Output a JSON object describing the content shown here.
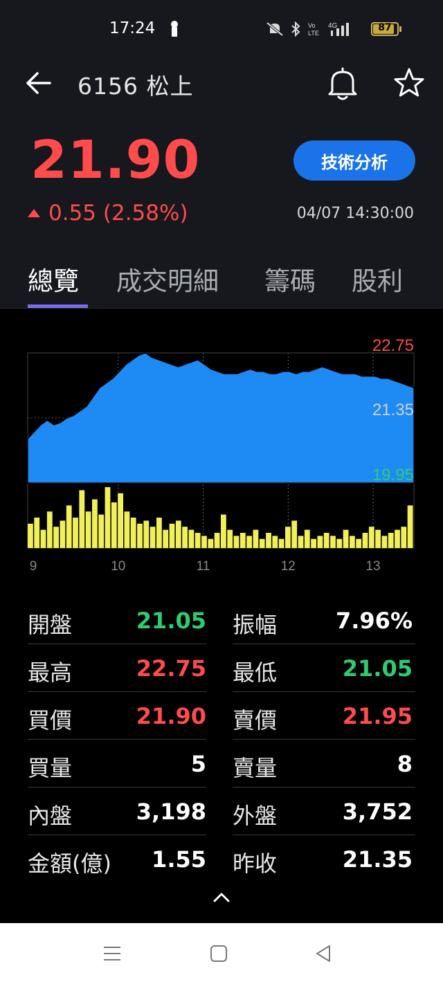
{
  "status_bar": {
    "time": "17:24",
    "battery": "87",
    "battery_level": 0.87,
    "icons": [
      "lock-icon",
      "mute-icon",
      "bluetooth-icon",
      "volte-icon",
      "4g-signal-icon",
      "battery-icon"
    ]
  },
  "header": {
    "title": "6156 松上",
    "icons": [
      "back-arrow-icon",
      "bell-icon",
      "star-icon"
    ]
  },
  "quote": {
    "price": "21.90",
    "change": "0.55 (2.58%)",
    "datetime": "04/07 14:30:00",
    "tech_button": "技術分析",
    "colors": {
      "up": "#ff4b4b",
      "down": "#2ecc71",
      "accent": "#1a73e8"
    }
  },
  "tabs": [
    {
      "label": "總覽",
      "active": true
    },
    {
      "label": "成交明細",
      "active": false
    },
    {
      "label": "籌碼",
      "active": false
    },
    {
      "label": "股利",
      "active": false
    }
  ],
  "chart_data": {
    "type": "area",
    "y_labels": {
      "high": "22.75",
      "mid": "21.35",
      "low": "19.95"
    },
    "ylim": [
      19.95,
      22.75
    ],
    "x_ticks": [
      "9",
      "10",
      "11",
      "12",
      "13"
    ],
    "price_series": [
      20.9,
      21.05,
      21.2,
      21.3,
      21.2,
      21.25,
      21.35,
      21.4,
      21.5,
      21.6,
      21.8,
      22.0,
      22.1,
      22.2,
      22.35,
      22.5,
      22.6,
      22.7,
      22.75,
      22.65,
      22.6,
      22.55,
      22.5,
      22.45,
      22.5,
      22.55,
      22.6,
      22.5,
      22.4,
      22.35,
      22.3,
      22.3,
      22.3,
      22.35,
      22.4,
      22.35,
      22.35,
      22.3,
      22.3,
      22.35,
      22.35,
      22.3,
      22.35,
      22.35,
      22.4,
      22.45,
      22.4,
      22.35,
      22.3,
      22.3,
      22.3,
      22.25,
      22.25,
      22.25,
      22.2,
      22.2,
      22.15,
      22.1,
      22.05,
      22.0
    ],
    "volume_series": [
      0.4,
      0.5,
      0.3,
      0.6,
      0.35,
      0.45,
      0.7,
      0.5,
      0.95,
      0.6,
      0.8,
      0.55,
      1.0,
      0.75,
      0.9,
      0.6,
      0.5,
      0.4,
      0.45,
      0.35,
      0.5,
      0.3,
      0.4,
      0.45,
      0.35,
      0.3,
      0.25,
      0.2,
      0.15,
      0.25,
      0.55,
      0.3,
      0.2,
      0.25,
      0.2,
      0.3,
      0.15,
      0.25,
      0.2,
      0.15,
      0.35,
      0.45,
      0.2,
      0.3,
      0.15,
      0.2,
      0.25,
      0.2,
      0.15,
      0.3,
      0.2,
      0.15,
      0.25,
      0.35,
      0.3,
      0.2,
      0.25,
      0.3,
      0.35,
      0.7
    ]
  },
  "stats": [
    {
      "label": "開盤",
      "value": "21.05",
      "color": "#2ecc71",
      "label2": "振幅",
      "value2": "7.96%",
      "color2": "#ffffff"
    },
    {
      "label": "最高",
      "value": "22.75",
      "color": "#ff4b4b",
      "label2": "最低",
      "value2": "21.05",
      "color2": "#2ecc71"
    },
    {
      "label": "買價",
      "value": "21.90",
      "color": "#ff4b4b",
      "label2": "賣價",
      "value2": "21.95",
      "color2": "#ff4b4b"
    },
    {
      "label": "買量",
      "value": "5",
      "color": "#ffffff",
      "label2": "賣量",
      "value2": "8",
      "color2": "#ffffff"
    },
    {
      "label": "內盤",
      "value": "3,198",
      "color": "#ffffff",
      "label2": "外盤",
      "value2": "3,752",
      "color2": "#ffffff"
    },
    {
      "label": "金額(億)",
      "value": "1.55",
      "color": "#ffffff",
      "label2": "昨收",
      "value2": "21.35",
      "color2": "#ffffff"
    }
  ],
  "nav": {
    "icons": [
      "menu-icon",
      "home-icon",
      "back-triangle-icon"
    ]
  }
}
